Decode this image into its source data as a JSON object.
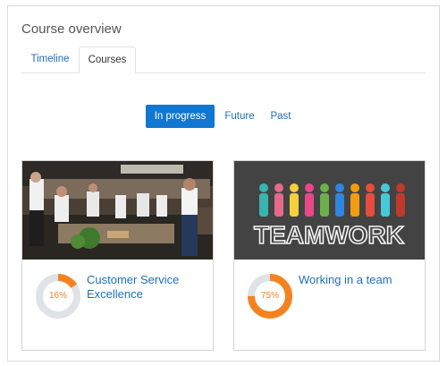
{
  "block": {
    "title": "Course overview"
  },
  "tabs": [
    {
      "label": "Timeline"
    },
    {
      "label": "Courses"
    }
  ],
  "filters": [
    {
      "label": "In progress"
    },
    {
      "label": "Future"
    },
    {
      "label": "Past"
    }
  ],
  "courses": [
    {
      "name": "Customer Service Excellence",
      "progress_label": "16%",
      "progress": 16,
      "image": "kitchen-staff-photo"
    },
    {
      "name": "Working in a team",
      "progress_label": "75%",
      "progress": 75,
      "image": "teamwork-chalkboard",
      "image_text": "TEAMWORK"
    }
  ],
  "colors": {
    "accent": "#1177d1",
    "link": "#1f6fb5",
    "progress": "#f58220",
    "track": "#dfe2e6"
  }
}
